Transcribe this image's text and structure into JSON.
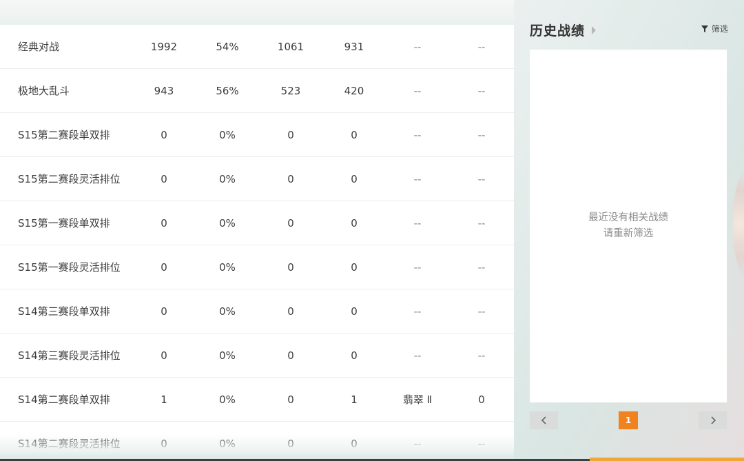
{
  "stats_table": {
    "rows": [
      {
        "mode": "经典对战",
        "total": "1992",
        "rate": "54%",
        "wins": "1061",
        "losses": "931",
        "rank": "--",
        "points": "--"
      },
      {
        "mode": "极地大乱斗",
        "total": "943",
        "rate": "56%",
        "wins": "523",
        "losses": "420",
        "rank": "--",
        "points": "--"
      },
      {
        "mode": "S15第二赛段单双排",
        "total": "0",
        "rate": "0%",
        "wins": "0",
        "losses": "0",
        "rank": "--",
        "points": "--"
      },
      {
        "mode": "S15第二赛段灵活排位",
        "total": "0",
        "rate": "0%",
        "wins": "0",
        "losses": "0",
        "rank": "--",
        "points": "--"
      },
      {
        "mode": "S15第一赛段单双排",
        "total": "0",
        "rate": "0%",
        "wins": "0",
        "losses": "0",
        "rank": "--",
        "points": "--"
      },
      {
        "mode": "S15第一赛段灵活排位",
        "total": "0",
        "rate": "0%",
        "wins": "0",
        "losses": "0",
        "rank": "--",
        "points": "--"
      },
      {
        "mode": "S14第三赛段单双排",
        "total": "0",
        "rate": "0%",
        "wins": "0",
        "losses": "0",
        "rank": "--",
        "points": "--"
      },
      {
        "mode": "S14第三赛段灵活排位",
        "total": "0",
        "rate": "0%",
        "wins": "0",
        "losses": "0",
        "rank": "--",
        "points": "--"
      },
      {
        "mode": "S14第二赛段单双排",
        "total": "1",
        "rate": "0%",
        "wins": "0",
        "losses": "1",
        "rank": "翡翠 Ⅱ",
        "points": "0"
      },
      {
        "mode": "S14第二赛段灵活排位",
        "total": "0",
        "rate": "0%",
        "wins": "0",
        "losses": "0",
        "rank": "--",
        "points": "--"
      }
    ]
  },
  "history": {
    "title": "历史战绩",
    "filter_label": "筛选",
    "empty_line1": "最近没有相关战绩",
    "empty_line2": "请重新筛选",
    "current_page": "1"
  },
  "icons": {
    "history_arrow": "caret-right-icon",
    "filter": "funnel-icon",
    "prev": "chevron-left-icon",
    "next": "chevron-right-icon"
  },
  "colors": {
    "accent": "#f0831f",
    "panel_bg": "#ffffff",
    "pager_bg": "#d9dcdb"
  }
}
